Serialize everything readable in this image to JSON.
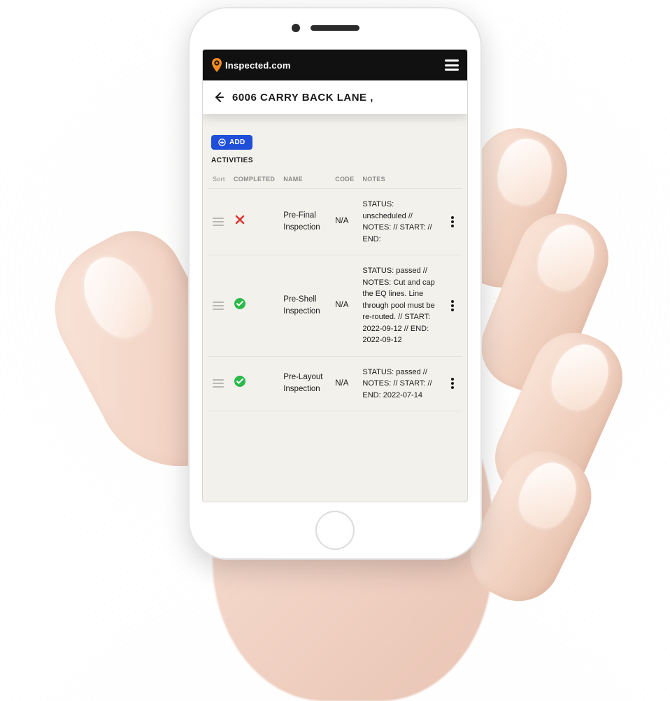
{
  "brand": {
    "name": "Inspected.com"
  },
  "page": {
    "address": "6006 CARRY BACK LANE ,",
    "add_button_label": "ADD",
    "section_title": "ACTIVITIES"
  },
  "table": {
    "headers": {
      "sort": "Sort",
      "completed": "COMPLETED",
      "name": "NAME",
      "code": "CODE",
      "notes": "NOTES"
    },
    "rows": [
      {
        "completed": false,
        "status_icon": "x-icon",
        "name": "Pre-Final Inspection",
        "code": "N/A",
        "notes": "STATUS: unscheduled // NOTES: // START: // END:"
      },
      {
        "completed": true,
        "status_icon": "check-icon",
        "name": "Pre-Shell Inspection",
        "code": "N/A",
        "notes": "STATUS: passed // NOTES: Cut and cap the EQ lines. Line through pool must be re-routed. // START: 2022-09-12 // END: 2022-09-12"
      },
      {
        "completed": true,
        "status_icon": "check-icon",
        "name": "Pre-Layout Inspection",
        "code": "N/A",
        "notes": "STATUS: passed // NOTES: // START: // END: 2022-07-14"
      }
    ]
  },
  "colors": {
    "accent": "#1f4fd8",
    "brand_pin": "#f28c1f",
    "success": "#2ab94a",
    "fail": "#e0332e"
  }
}
